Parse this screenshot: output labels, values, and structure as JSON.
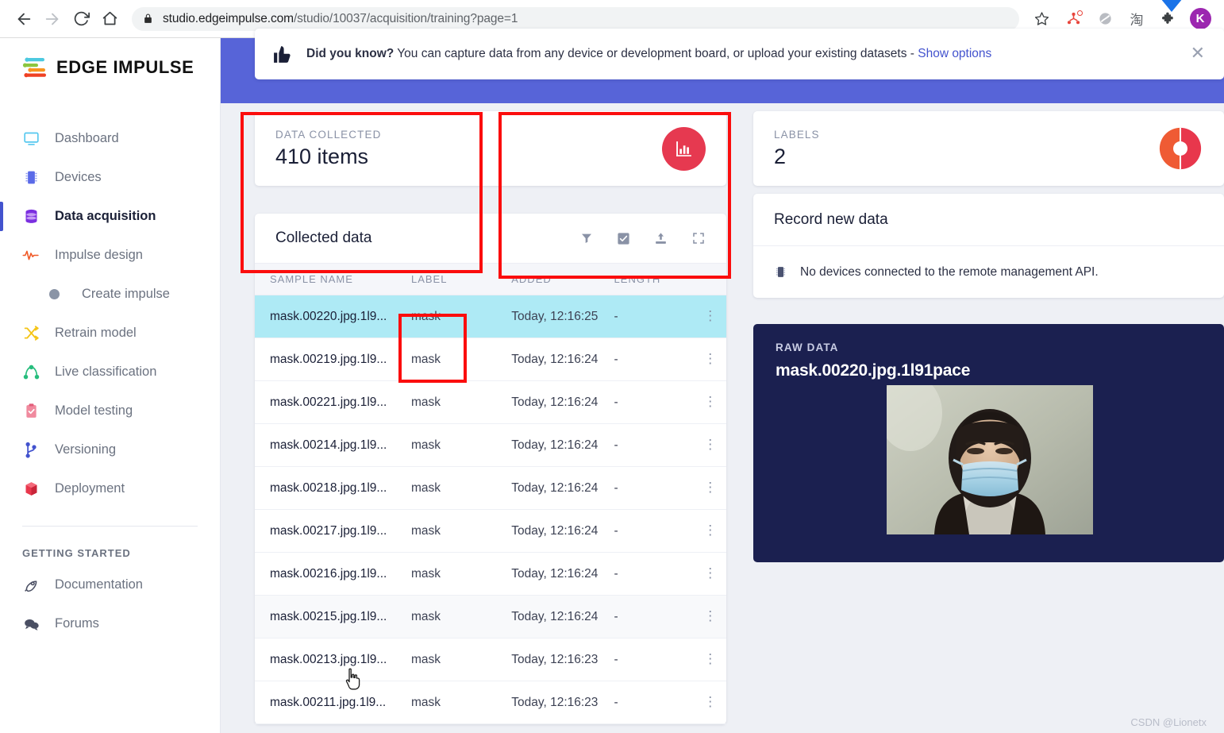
{
  "browser": {
    "back_icon": "back-arrow-icon",
    "forward_icon": "forward-arrow-icon",
    "reload_icon": "reload-icon",
    "home_icon": "home-icon",
    "lock_icon": "lock-icon",
    "url_domain": "studio.edgeimpulse.com",
    "url_path": "/studio/10037/acquisition/training?page=1",
    "url_full": "studio.edgeimpulse.com/studio/10037/acquisition/training?page=1",
    "toolbar_icons": [
      {
        "name": "bookmark-star-icon",
        "glyph": "star"
      },
      {
        "name": "extension-network-icon",
        "glyph": "network",
        "badge": true
      },
      {
        "name": "grey-circle-icon",
        "glyph": "circle"
      },
      {
        "name": "taobao-icon",
        "glyph": "淘"
      },
      {
        "name": "extensions-puzzle-icon",
        "glyph": "puzzle"
      },
      {
        "name": "profile-avatar",
        "glyph": "K"
      }
    ],
    "avatar_letter": "K",
    "avatar_color": "#9c27b0"
  },
  "sidebar": {
    "brand": "EDGE IMPULSE",
    "items": [
      {
        "label": "Dashboard",
        "icon": "monitor-icon",
        "active": false
      },
      {
        "label": "Devices",
        "icon": "chip-icon",
        "active": false
      },
      {
        "label": "Data acquisition",
        "icon": "database-icon",
        "active": true
      },
      {
        "label": "Impulse design",
        "icon": "pulse-wave-icon",
        "active": false
      }
    ],
    "sub_item": {
      "label": "Create impulse",
      "icon": "dot-icon"
    },
    "items2": [
      {
        "label": "Retrain model",
        "icon": "shuffle-icon"
      },
      {
        "label": "Live classification",
        "icon": "graph-nodes-icon"
      },
      {
        "label": "Model testing",
        "icon": "clipboard-check-icon"
      },
      {
        "label": "Versioning",
        "icon": "branch-icon"
      },
      {
        "label": "Deployment",
        "icon": "box-icon"
      }
    ],
    "section_caption": "GETTING STARTED",
    "items3": [
      {
        "label": "Documentation",
        "icon": "rocket-icon"
      },
      {
        "label": "Forums",
        "icon": "chat-bubbles-icon"
      }
    ],
    "active_indicator_color": "#4353ce"
  },
  "banner": {
    "icon": "thumbs-up-icon",
    "bold_lead": "Did you know?",
    "message": " You can capture data from any device or development board, or upload your existing datasets - ",
    "link": "Show options",
    "close_icon": "close-icon",
    "close_glyph": "✕"
  },
  "stats": [
    {
      "label": "DATA COLLECTED",
      "value": "410 items",
      "icon": "bar-chart-icon",
      "accent": "#e63950"
    },
    {
      "label": "LABELS",
      "value": "2",
      "icon": "donut-chart-icon",
      "accent": "#e63950"
    }
  ],
  "table": {
    "title": "Collected data",
    "tools": [
      {
        "name": "filter-icon"
      },
      {
        "name": "select-checkbox-icon"
      },
      {
        "name": "upload-icon"
      },
      {
        "name": "expand-fullscreen-icon"
      }
    ],
    "columns": [
      "SAMPLE NAME",
      "LABEL",
      "ADDED",
      "LENGTH"
    ],
    "rows": [
      {
        "name": "mask.00220.jpg.1l9...",
        "label": "mask",
        "added": "Today, 12:16:25",
        "length": "-",
        "state": "selected"
      },
      {
        "name": "mask.00219.jpg.1l9...",
        "label": "mask",
        "added": "Today, 12:16:24",
        "length": "-",
        "state": ""
      },
      {
        "name": "mask.00221.jpg.1l9...",
        "label": "mask",
        "added": "Today, 12:16:24",
        "length": "-",
        "state": ""
      },
      {
        "name": "mask.00214.jpg.1l9...",
        "label": "mask",
        "added": "Today, 12:16:24",
        "length": "-",
        "state": ""
      },
      {
        "name": "mask.00218.jpg.1l9...",
        "label": "mask",
        "added": "Today, 12:16:24",
        "length": "-",
        "state": ""
      },
      {
        "name": "mask.00217.jpg.1l9...",
        "label": "mask",
        "added": "Today, 12:16:24",
        "length": "-",
        "state": ""
      },
      {
        "name": "mask.00216.jpg.1l9...",
        "label": "mask",
        "added": "Today, 12:16:24",
        "length": "-",
        "state": ""
      },
      {
        "name": "mask.00215.jpg.1l9...",
        "label": "mask",
        "added": "Today, 12:16:24",
        "length": "-",
        "state": "hovered"
      },
      {
        "name": "mask.00213.jpg.1l9...",
        "label": "mask",
        "added": "Today, 12:16:23",
        "length": "-",
        "state": ""
      },
      {
        "name": "mask.00211.jpg.1l9...",
        "label": "mask",
        "added": "Today, 12:16:23",
        "length": "-",
        "state": ""
      }
    ],
    "row_menu_glyph": "⋮"
  },
  "record_panel": {
    "title": "Record new data",
    "icon": "chip-icon",
    "message": "No devices connected to the remote management API."
  },
  "raw_panel": {
    "label": "RAW DATA",
    "title": "mask.00220.jpg.1l91pace",
    "image_alt": "person-wearing-face-mask-photo",
    "background": "#1b2050"
  },
  "watermark": "CSDN @Lionetx",
  "annotations": [
    {
      "name": "annotation-data-collected-card"
    },
    {
      "name": "annotation-labels-card"
    },
    {
      "name": "annotation-label-column"
    }
  ]
}
